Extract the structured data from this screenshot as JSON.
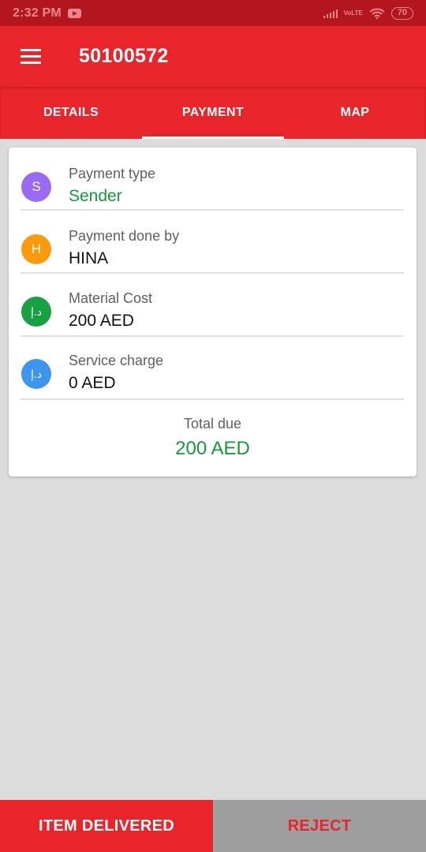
{
  "status_bar": {
    "time": "2:32 PM",
    "network_label": "VoLTE",
    "battery": "70"
  },
  "app_bar": {
    "title": "50100572",
    "color": "#e8252b"
  },
  "tabs": [
    {
      "label": "DETAILS",
      "active": false
    },
    {
      "label": "PAYMENT",
      "active": true
    },
    {
      "label": "MAP",
      "active": false
    }
  ],
  "payment": {
    "rows": [
      {
        "avatar": "S",
        "avatar_color": "#9a6bf0",
        "label": "Payment type",
        "value": "Sender"
      },
      {
        "avatar": "H",
        "avatar_color": "#fd9a0c",
        "label": "Payment done by",
        "value": "HINA"
      },
      {
        "avatar": "د.إ",
        "avatar_color": "#1aa044",
        "label": "Material Cost",
        "value": "200 AED"
      },
      {
        "avatar": "د.إ",
        "avatar_color": "#3d95ef",
        "label": "Service charge",
        "value": "0 AED"
      }
    ],
    "total_label": "Total due",
    "total_value": "200 AED"
  },
  "actions": {
    "delivered_label": "ITEM DELIVERED",
    "reject_label": "REJECT"
  }
}
